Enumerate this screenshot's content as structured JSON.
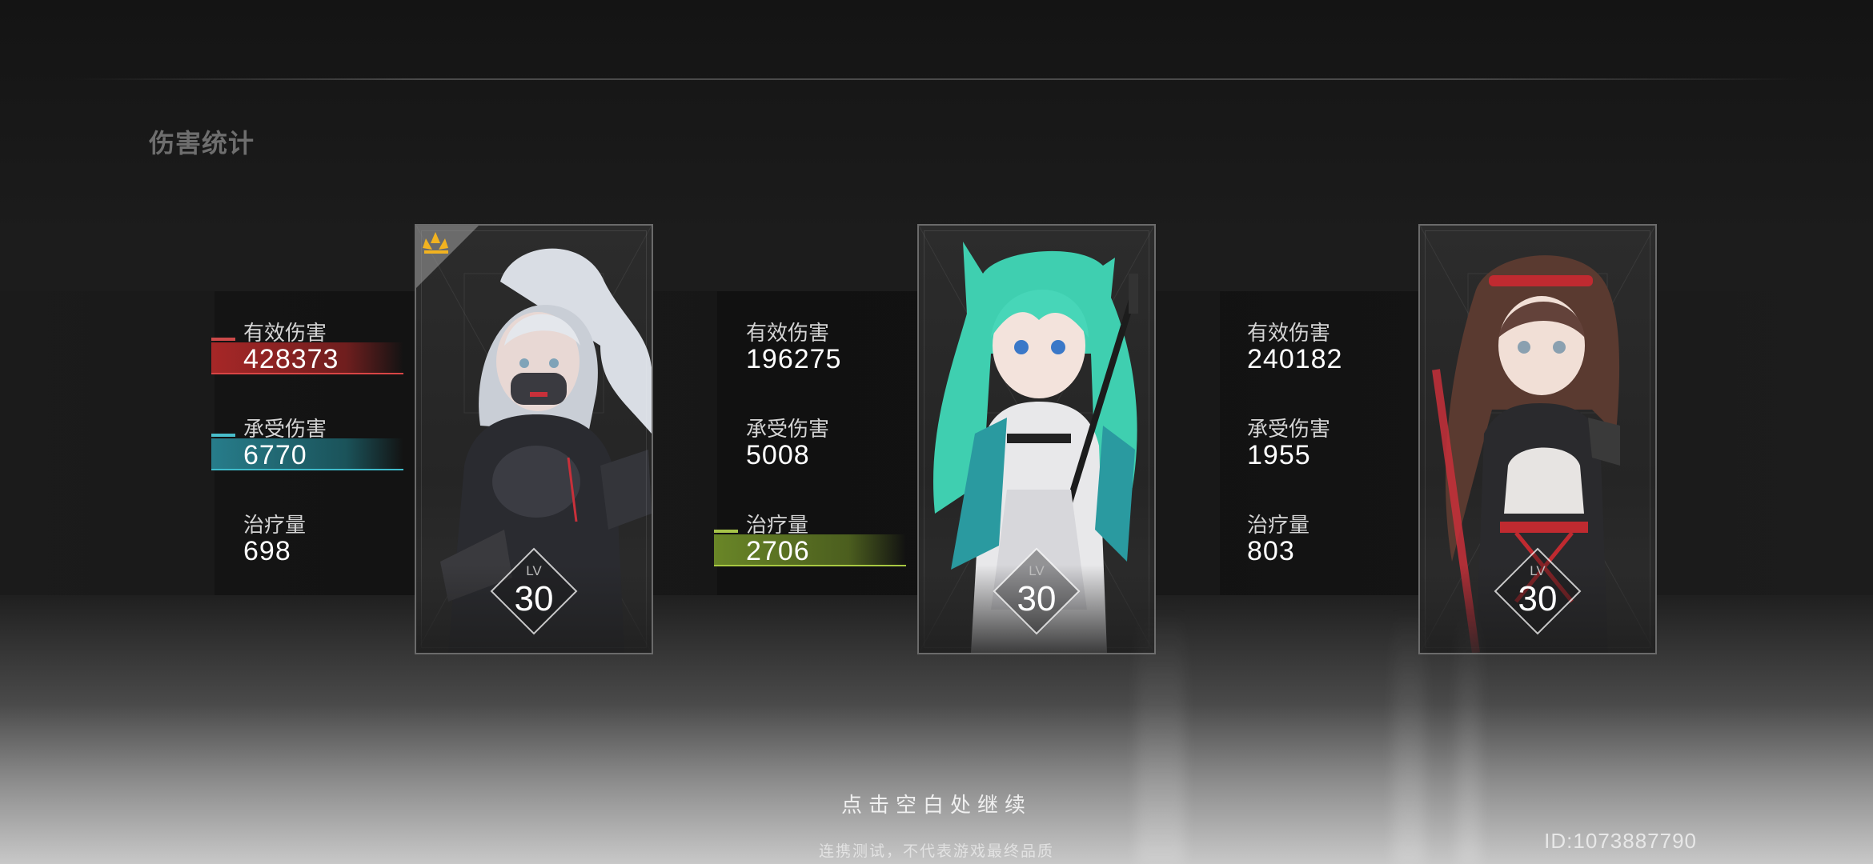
{
  "page_title": "伤害统计",
  "labels": {
    "effective_damage": "有效伤害",
    "damage_taken": "承受伤害",
    "healing": "治疗量",
    "level": "LV"
  },
  "characters": [
    {
      "effective_damage": "428373",
      "damage_taken": "6770",
      "healing": "698",
      "level": "30",
      "highlights": [
        "effective_damage",
        "damage_taken"
      ],
      "mvp": true,
      "hair_color": "#dcdfe6",
      "accent_color": "#c8303a"
    },
    {
      "effective_damage": "196275",
      "damage_taken": "5008",
      "healing": "2706",
      "level": "30",
      "highlights": [
        "healing"
      ],
      "mvp": false,
      "hair_color": "#3fcfb0",
      "accent_color": "#2a9aa0"
    },
    {
      "effective_damage": "240182",
      "damage_taken": "1955",
      "healing": "803",
      "level": "30",
      "highlights": [],
      "mvp": false,
      "hair_color": "#5a3a30",
      "accent_color": "#c02a30"
    }
  ],
  "colors": {
    "highlight_damage": "#c03535",
    "highlight_taken": "#2f9aa8",
    "highlight_healing": "#8aa83a",
    "mvp_badge": "#f2b320"
  },
  "footer": {
    "continue_hint": "点击空白处继续",
    "disclaimer": "连携测试，不代表游戏最终品质",
    "user_id": "ID:1073887790"
  }
}
